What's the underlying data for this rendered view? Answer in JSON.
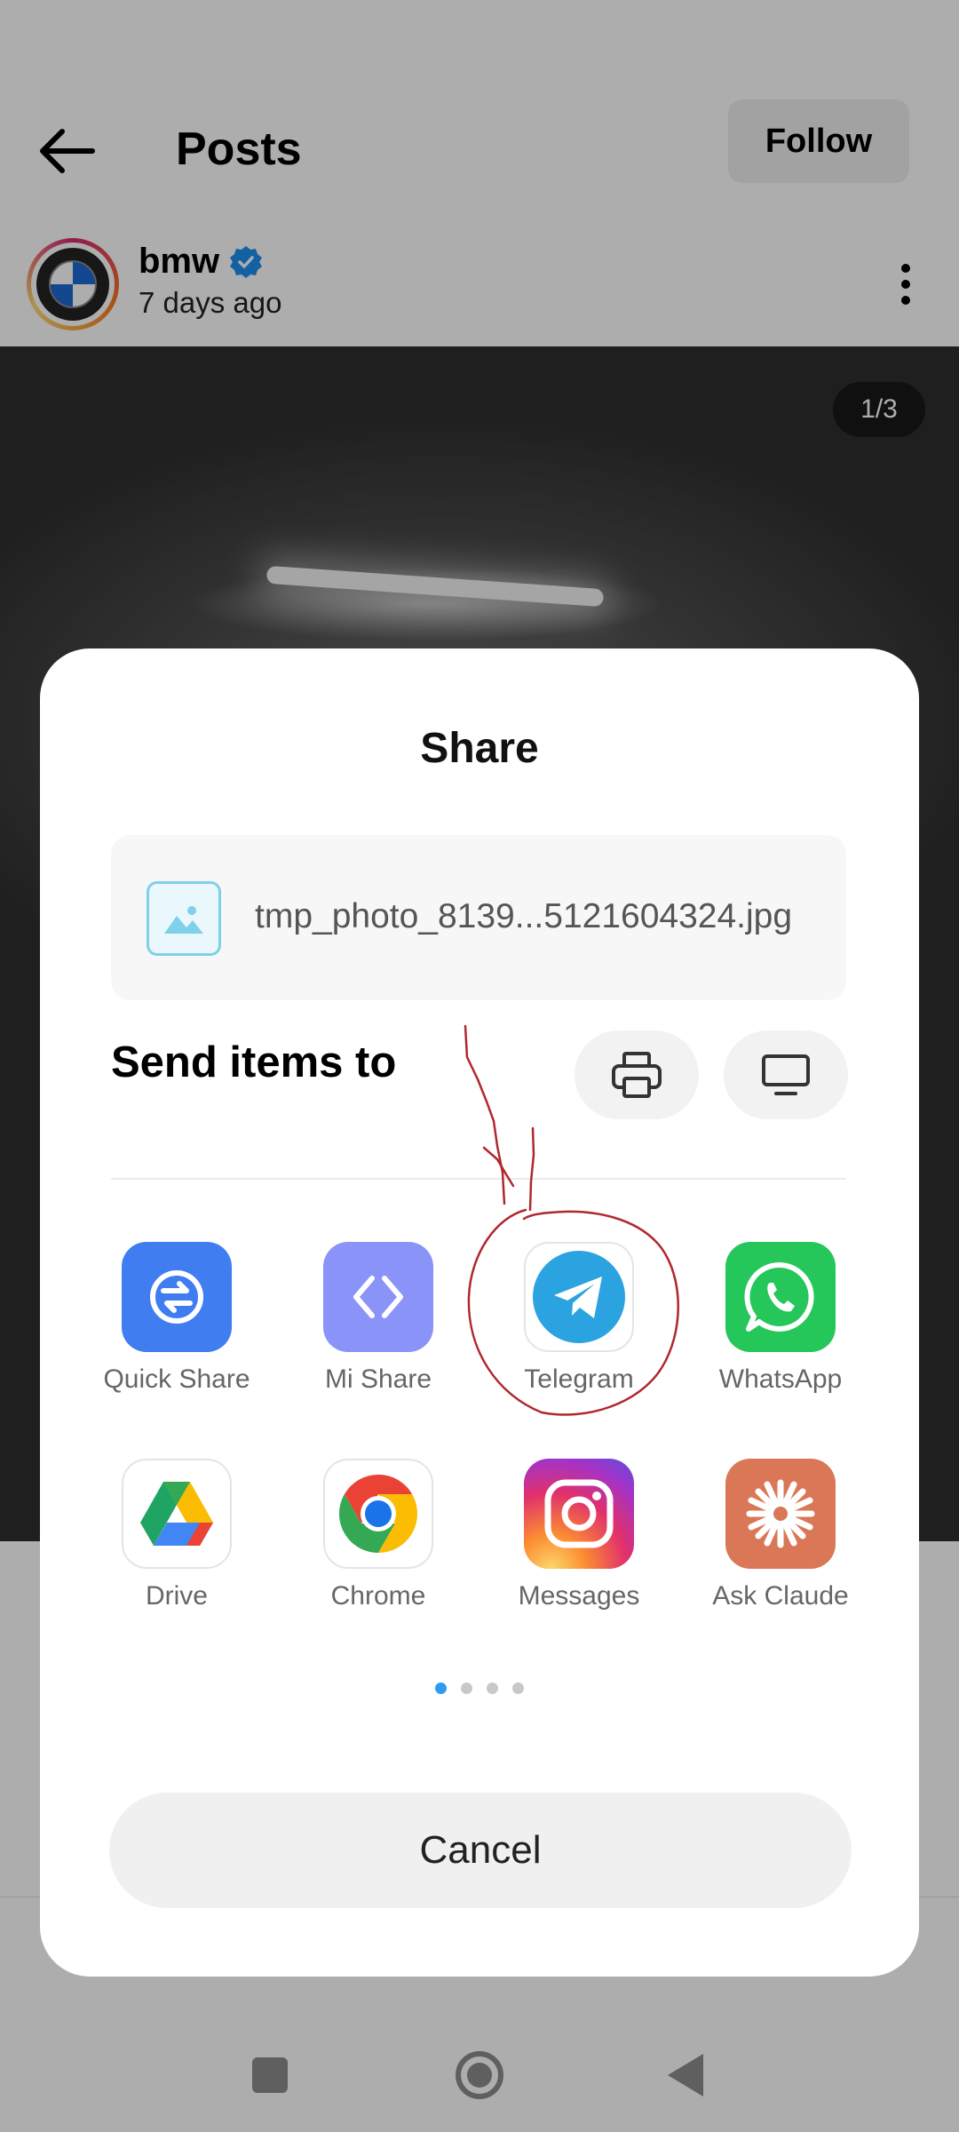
{
  "header": {
    "title": "Posts",
    "follow_label": "Follow"
  },
  "post": {
    "username": "bmw",
    "time": "7 days ago",
    "image_counter": "1/3"
  },
  "share": {
    "title": "Share",
    "file_name": "tmp_photo_8139...5121604324.jpg",
    "send_label": "Send items to",
    "apps": [
      {
        "label": "Quick Share",
        "icon": "quick-share-icon",
        "color": "#3f7df0"
      },
      {
        "label": "Mi Share",
        "icon": "mi-share-icon",
        "color": "#8a93f7"
      },
      {
        "label": "Telegram",
        "icon": "telegram-icon",
        "color": "#2aa3e0"
      },
      {
        "label": "WhatsApp",
        "icon": "whatsapp-icon",
        "color": "#25c65a"
      },
      {
        "label": "Drive",
        "icon": "google-drive-icon",
        "color": "#1fa463"
      },
      {
        "label": "Chrome",
        "icon": "chrome-icon",
        "color": "#1a73e8"
      },
      {
        "label": "Messages",
        "icon": "instagram-icon",
        "color": "#e1306c"
      },
      {
        "label": "Ask Claude",
        "icon": "claude-icon",
        "color": "#d97757"
      }
    ],
    "page_dots": {
      "count": 4,
      "active": 1
    },
    "cancel_label": "Cancel"
  },
  "colors": {
    "accent": "#2f9bf0",
    "annotation": "#b0282e",
    "verified": "#1d8ff0"
  }
}
